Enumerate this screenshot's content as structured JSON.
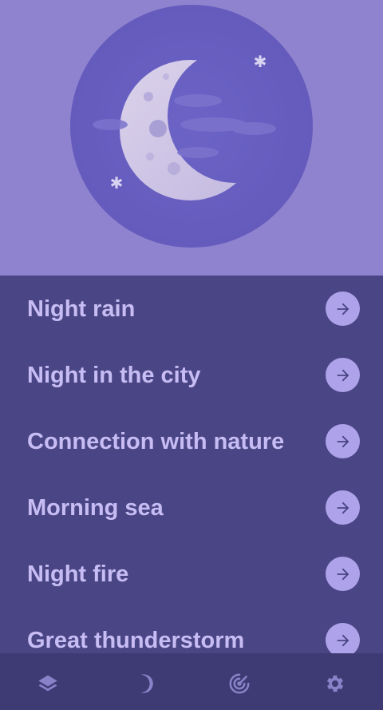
{
  "hero": {
    "image": "crescent-moon-night-illustration",
    "colors": {
      "background": "#8f83cf",
      "circle": "#645bbd",
      "moon": "#d8cfe6"
    }
  },
  "sounds": [
    {
      "label": "Night rain",
      "action_icon": "arrow-right-icon"
    },
    {
      "label": "Night in the city",
      "action_icon": "arrow-right-icon"
    },
    {
      "label": "Connection with nature",
      "action_icon": "arrow-right-icon"
    },
    {
      "label": "Morning sea",
      "action_icon": "arrow-right-icon"
    },
    {
      "label": "Night fire",
      "action_icon": "arrow-right-icon"
    },
    {
      "label": "Great thunderstorm",
      "action_icon": "arrow-right-icon"
    }
  ],
  "bottom_nav": {
    "items": [
      {
        "icon": "layers-icon",
        "active": false
      },
      {
        "icon": "moon-icon",
        "active": true
      },
      {
        "icon": "radar-icon",
        "active": false
      },
      {
        "icon": "gear-icon",
        "active": false
      }
    ],
    "colors": {
      "background": "#3e3a73",
      "icon": "#8a82c8"
    }
  },
  "colors": {
    "list_background": "#4a4584",
    "label": "#c7bdf4",
    "action_button": "#aea3ea",
    "action_arrow": "#4a4584"
  }
}
